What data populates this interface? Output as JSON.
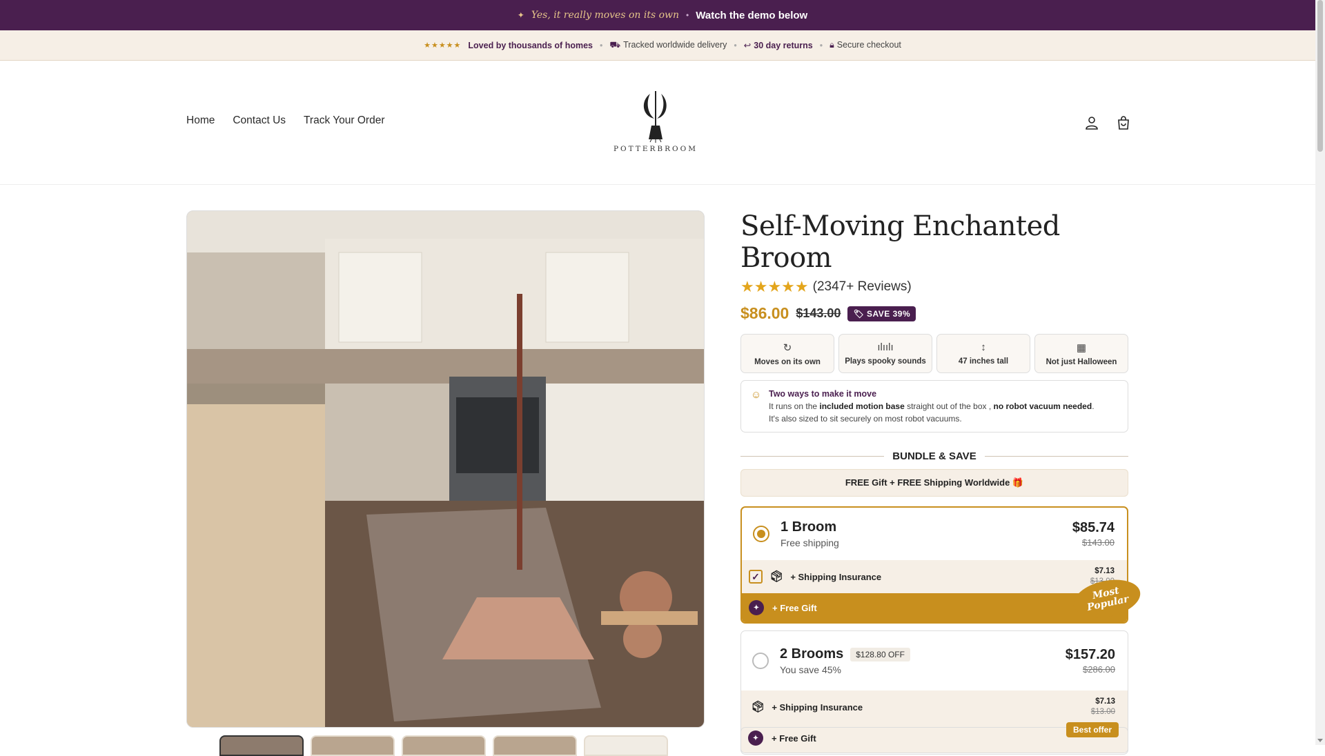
{
  "announcement": {
    "italic_text": "Yes, it really moves on its own",
    "link_text": "Watch the demo below"
  },
  "trust_bar": {
    "stars": "★★★★★",
    "loved": "Loved by thousands of homes",
    "delivery": "Tracked worldwide delivery",
    "returns": "30 day returns",
    "checkout": "Secure checkout"
  },
  "nav": {
    "items": [
      "Home",
      "Contact Us",
      "Track Your Order"
    ]
  },
  "brand": {
    "name": "POTTERBROOM"
  },
  "product": {
    "title": "Self-Moving Enchanted Broom",
    "stars": "★★★★★",
    "reviews": "(2347+ Reviews)",
    "price": "$86.00",
    "compare_price": "$143.00",
    "save_badge": "SAVE 39%"
  },
  "features": [
    {
      "label": "Moves on its own",
      "icon": "motion-icon"
    },
    {
      "label": "Plays spooky sounds",
      "icon": "sound-wave-icon"
    },
    {
      "label": "47 inches tall",
      "icon": "height-arrow-icon"
    },
    {
      "label": "Not just Halloween",
      "icon": "calendar-icon"
    }
  ],
  "note": {
    "title": "Two ways to make it move",
    "line1_a": "It runs on the ",
    "line1_b": "included motion base",
    "line1_c": " straight out of the box , ",
    "line1_d": "no robot vacuum needed",
    "line1_e": ".",
    "line2": "It's also sized to sit securely on most robot vacuums."
  },
  "bundle": {
    "header": "BUNDLE & SAVE",
    "free_bar": "FREE Gift + FREE Shipping Worldwide 🎁",
    "options": [
      {
        "title": "1 Broom",
        "subtitle": "Free shipping",
        "price": "$85.74",
        "compare": "$143.00",
        "insurance_label": "+ Shipping Insurance",
        "insurance_price": "$7.13",
        "insurance_compare": "$13.00",
        "gift_label": "+ Free Gift"
      },
      {
        "title": "2 Brooms",
        "off_badge": "$128.80 OFF",
        "subtitle": "You save 45%",
        "price": "$157.20",
        "compare": "$286.00",
        "insurance_label": "+ Shipping Insurance",
        "insurance_price": "$7.13",
        "insurance_compare": "$13.00",
        "gift_label": "+ Free Gift"
      }
    ],
    "most_popular": "Most Popular",
    "best_offer": "Best offer"
  },
  "colors": {
    "brand_purple": "#4a1f4f",
    "accent_gold": "#c88f1e",
    "cream": "#f6efe6"
  }
}
